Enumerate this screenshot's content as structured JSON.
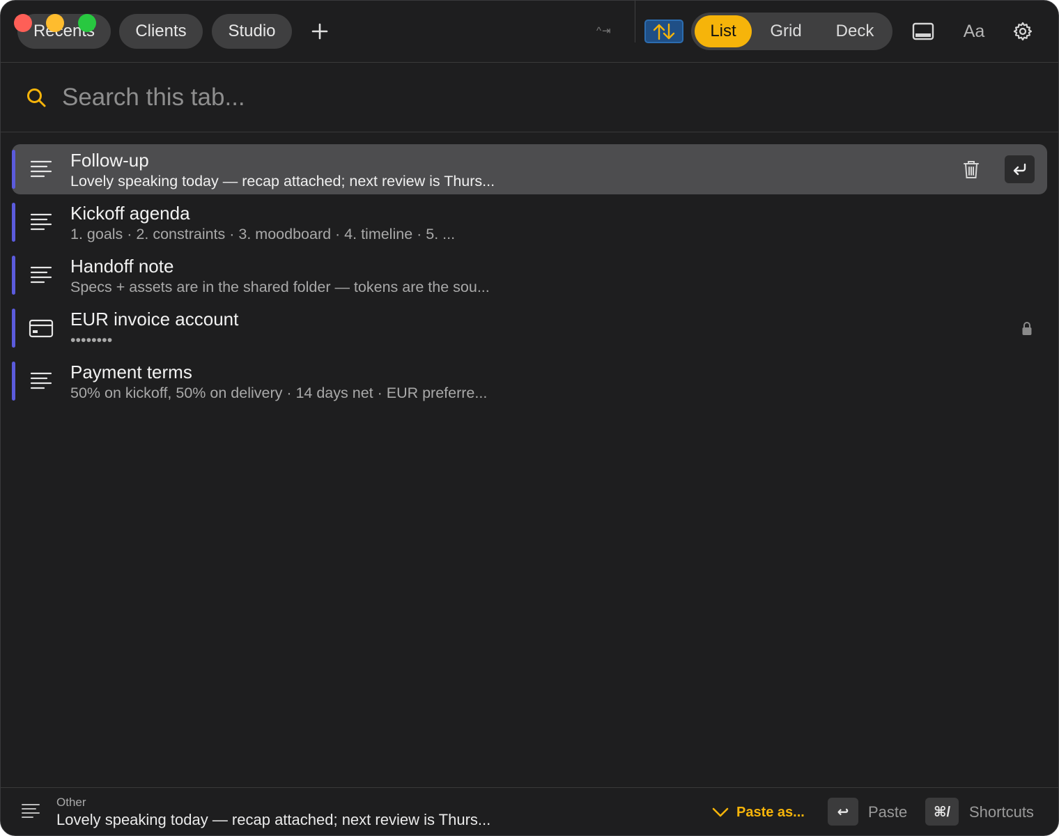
{
  "tabs": {
    "recents": "Recents",
    "clients": "Clients",
    "studio": "Studio"
  },
  "toolbar": {
    "shortcut_hint": "^⇥",
    "view_modes": [
      "List",
      "Grid",
      "Deck"
    ],
    "active_view": "List",
    "font_button": "Aa",
    "sort_icon": "sort-arrows-icon",
    "panel_icon": "bottom-panel-icon",
    "settings_icon": "gear-icon"
  },
  "search": {
    "placeholder": "Search this tab..."
  },
  "items": [
    {
      "title": "Follow-up",
      "subtitle": "Lovely speaking today — recap attached; next review is Thurs...",
      "icon": "text-lines-icon",
      "selected": true
    },
    {
      "title": "Kickoff agenda",
      "subtitle": "1. goals · 2. constraints · 3. moodboard · 4. timeline · 5. ...",
      "icon": "text-lines-icon"
    },
    {
      "title": "Handoff note",
      "subtitle": "Specs + assets are in the shared folder — tokens are the sou...",
      "icon": "text-lines-icon"
    },
    {
      "title": "EUR invoice account",
      "subtitle": "••••••••",
      "icon": "credit-card-icon",
      "locked": true
    },
    {
      "title": "Payment terms",
      "subtitle": "50% on kickoff, 50% on delivery · 14 days net · EUR preferre...",
      "icon": "text-lines-icon"
    }
  ],
  "footer": {
    "type_label": "Other",
    "preview": "Lovely speaking today — recap attached; next review is Thurs...",
    "paste_as": "Paste as...",
    "enter_key": "↩",
    "paste": "Paste",
    "shortcut_key": "⌘/",
    "shortcuts": "Shortcuts"
  },
  "colors": {
    "accent": "#f6b40a",
    "row_marker": "#5b5bdc",
    "background": "#1e1e1f"
  }
}
